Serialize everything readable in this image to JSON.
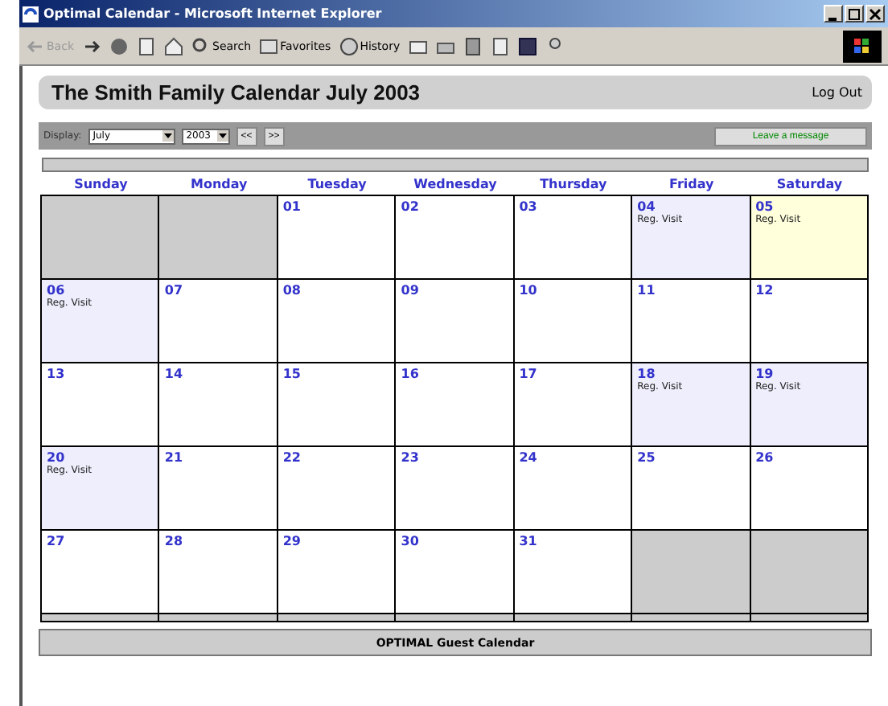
{
  "window": {
    "title": "Optimal Calendar - Microsoft Internet Explorer"
  },
  "toolbar": [
    {
      "kind": "back",
      "label": "Back",
      "disabled": true
    },
    {
      "kind": "forward",
      "disabled": false
    },
    {
      "kind": "stop"
    },
    {
      "kind": "refresh"
    },
    {
      "kind": "home"
    },
    {
      "kind": "search",
      "label": "Search"
    },
    {
      "kind": "favorites",
      "label": "Favorites"
    },
    {
      "kind": "history",
      "label": "History"
    },
    {
      "kind": "mail"
    },
    {
      "kind": "print"
    },
    {
      "kind": "edit"
    },
    {
      "kind": "discuss"
    },
    {
      "kind": "messenger"
    },
    {
      "kind": "user"
    }
  ],
  "header": {
    "title": "The Smith Family Calendar July 2003",
    "logout": "Log Out"
  },
  "nav": {
    "label": "Display:",
    "month": "July",
    "year": "2003",
    "prev": "<<",
    "next": ">>",
    "message_button": "Leave a message"
  },
  "weekdays": [
    "Sunday",
    "Monday",
    "Tuesday",
    "Wednesday",
    "Thursday",
    "Friday",
    "Saturday"
  ],
  "weeks": [
    [
      {
        "kind": "blank"
      },
      {
        "kind": "blank"
      },
      {
        "kind": "day",
        "date": "01",
        "color": "#ffffff"
      },
      {
        "kind": "day",
        "date": "02",
        "color": "#ffffff"
      },
      {
        "kind": "day",
        "date": "03",
        "color": "#ffffff"
      },
      {
        "kind": "day",
        "date": "04",
        "color": "#eeeefc",
        "event": "Reg. Visit"
      },
      {
        "kind": "day",
        "date": "05",
        "color": "#ffffdc",
        "event": "Reg. Visit"
      }
    ],
    [
      {
        "kind": "day",
        "date": "06",
        "color": "#eeeefc",
        "event": "Reg. Visit"
      },
      {
        "kind": "day",
        "date": "07",
        "color": "#ffffff"
      },
      {
        "kind": "day",
        "date": "08",
        "color": "#ffffff"
      },
      {
        "kind": "day",
        "date": "09",
        "color": "#ffffff"
      },
      {
        "kind": "day",
        "date": "10",
        "color": "#ffffff"
      },
      {
        "kind": "day",
        "date": "11",
        "color": "#ffffff"
      },
      {
        "kind": "day",
        "date": "12",
        "color": "#ffffff"
      }
    ],
    [
      {
        "kind": "day",
        "date": "13",
        "color": "#ffffff"
      },
      {
        "kind": "day",
        "date": "14",
        "color": "#ffffff"
      },
      {
        "kind": "day",
        "date": "15",
        "color": "#ffffff"
      },
      {
        "kind": "day",
        "date": "16",
        "color": "#ffffff"
      },
      {
        "kind": "day",
        "date": "17",
        "color": "#ffffff"
      },
      {
        "kind": "day",
        "date": "18",
        "color": "#eeeefc",
        "event": "Reg. Visit"
      },
      {
        "kind": "day",
        "date": "19",
        "color": "#eeeefc",
        "event": "Reg. Visit"
      }
    ],
    [
      {
        "kind": "day",
        "date": "20",
        "color": "#eeeefc",
        "event": "Reg. Visit"
      },
      {
        "kind": "day",
        "date": "21",
        "color": "#ffffff"
      },
      {
        "kind": "day",
        "date": "22",
        "color": "#ffffff"
      },
      {
        "kind": "day",
        "date": "23",
        "color": "#ffffff"
      },
      {
        "kind": "day",
        "date": "24",
        "color": "#ffffff"
      },
      {
        "kind": "day",
        "date": "25",
        "color": "#ffffff"
      },
      {
        "kind": "day",
        "date": "26",
        "color": "#ffffff"
      }
    ],
    [
      {
        "kind": "day",
        "date": "27",
        "color": "#ffffff"
      },
      {
        "kind": "day",
        "date": "28",
        "color": "#ffffff"
      },
      {
        "kind": "day",
        "date": "29",
        "color": "#ffffff"
      },
      {
        "kind": "day",
        "date": "30",
        "color": "#ffffff"
      },
      {
        "kind": "day",
        "date": "31",
        "color": "#ffffff"
      },
      {
        "kind": "blank"
      },
      {
        "kind": "blank"
      }
    ]
  ],
  "footer": "OPTIMAL Guest Calendar"
}
